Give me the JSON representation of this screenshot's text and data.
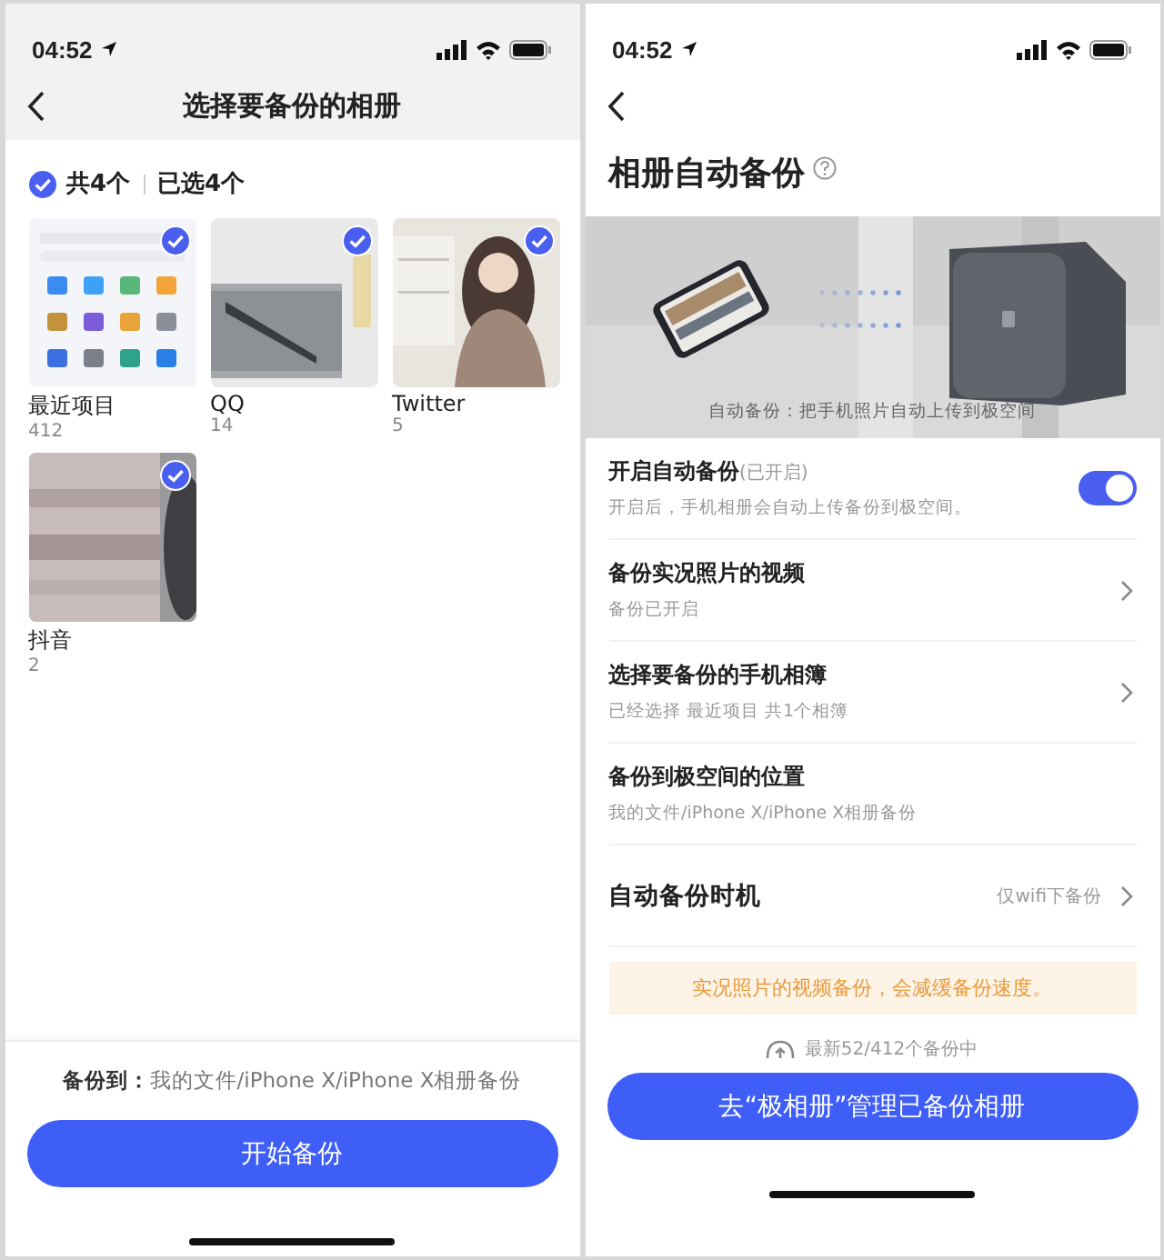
{
  "album_picker": {
    "status_bar": {
      "time": "04:52"
    },
    "title": "选择要备份的相册",
    "select_all": {
      "checked": true,
      "total": "共4个",
      "selected_count": "已选4个"
    },
    "albums": [
      {
        "name": "最近项目",
        "count": "412",
        "selected": true
      },
      {
        "name": "QQ",
        "count": "14",
        "selected": true
      },
      {
        "name": "Twitter",
        "count": "5",
        "selected": true
      },
      {
        "name": "抖音",
        "count": "2",
        "selected": true
      }
    ],
    "destination": {
      "label": "备份到：",
      "path": "我的文件/iPhone X/iPhone X相册备份"
    },
    "start_button": "开始备份"
  },
  "auto_backup": {
    "status_bar": {
      "time": "04:52"
    },
    "title": "相册自动备份",
    "banner_caption": "自动备份：把手机照片自动上传到极空间",
    "settings": [
      {
        "kind": "toggle",
        "title": "开启自动备份",
        "note": "(已开启)",
        "subtitle": "开启后，手机相册会自动上传备份到极空间。",
        "on": true
      },
      {
        "kind": "link",
        "title": "备份实况照片的视频",
        "subtitle": "备份已开启"
      },
      {
        "kind": "link",
        "title": "选择要备份的手机相簿",
        "subtitle": "已经选择 最近项目 共1个相簿"
      },
      {
        "kind": "info",
        "title": "备份到极空间的位置",
        "subtitle": "我的文件/iPhone X/iPhone X相册备份"
      },
      {
        "kind": "link",
        "title": "自动备份时机",
        "value": "仅wifi下备份"
      }
    ],
    "notice": "实况照片的视频备份，会减缓备份速度。",
    "progress": "最新52/412个备份中",
    "manage_button": "去“极相册”管理已备份相册"
  }
}
